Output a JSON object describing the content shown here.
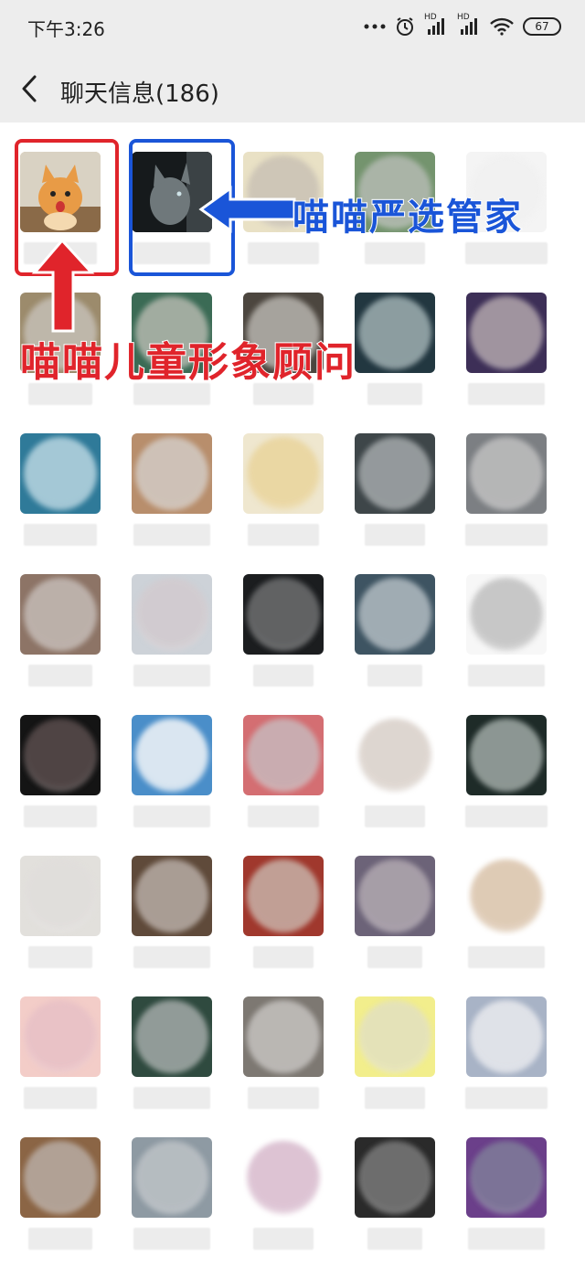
{
  "status_bar": {
    "time": "下午3:26",
    "battery": "67",
    "signal_label_1": "HD",
    "signal_label_2": "HD",
    "icons": [
      "more-dots-icon",
      "alarm-icon",
      "signal-icon",
      "signal-icon",
      "wifi-icon",
      "battery-icon"
    ]
  },
  "header": {
    "title": "聊天信息(186)",
    "back_icon": "chevron-left-icon"
  },
  "annotations": {
    "left_label": "喵喵儿童形象顾问",
    "right_label": "喵喵严选管家",
    "left_color": "#e0242b",
    "right_color": "#1a55d8"
  },
  "members": [
    {
      "avatar": "cat-photo",
      "bg": "#c9a57a",
      "blob": "#e7b27a"
    },
    {
      "avatar": "cat-photo-dark",
      "bg": "#1e2326",
      "blob": "#5c6466"
    },
    {
      "avatar": "blurred",
      "bg": "#e9e1c5",
      "blob": "#c9c1b4"
    },
    {
      "avatar": "blurred",
      "bg": "#74946e",
      "blob": "#b4bab2"
    },
    {
      "avatar": "blurred",
      "bg": "#f4f4f4",
      "blob": "#f0f0f0"
    },
    {
      "avatar": "blurred",
      "bg": "#9c8b6c",
      "blob": "#c5bfb6"
    },
    {
      "avatar": "blurred",
      "bg": "#3b6b55",
      "blob": "#b4b8ae"
    },
    {
      "avatar": "blurred",
      "bg": "#4c463f",
      "blob": "#b7b4ae"
    },
    {
      "avatar": "blurred",
      "bg": "#223740",
      "blob": "#9fb0b2"
    },
    {
      "avatar": "blurred",
      "bg": "#3d2f57",
      "blob": "#b2a6ac"
    },
    {
      "avatar": "blurred",
      "bg": "#2f7a99",
      "blob": "#b9d6e1"
    },
    {
      "avatar": "blurred",
      "bg": "#b88e6c",
      "blob": "#d2cbc5"
    },
    {
      "avatar": "blurred",
      "bg": "#efe7cf",
      "blob": "#e9d49c"
    },
    {
      "avatar": "blurred",
      "bg": "#3e4649",
      "blob": "#a4a9ab"
    },
    {
      "avatar": "blurred",
      "bg": "#7c7f83",
      "blob": "#c0c0c0"
    },
    {
      "avatar": "blurred",
      "bg": "#8d7466",
      "blob": "#c4bbb6"
    },
    {
      "avatar": "blurred",
      "bg": "#cdd2d8",
      "blob": "#d2cbcf"
    },
    {
      "avatar": "blurred",
      "bg": "#1b1d1f",
      "blob": "#6e6f70"
    },
    {
      "avatar": "blurred",
      "bg": "#3e5462",
      "blob": "#b2bcc2"
    },
    {
      "avatar": "blurred",
      "bg": "#f7f7f7",
      "blob": "#bfbfbf"
    },
    {
      "avatar": "blurred",
      "bg": "#141414",
      "blob": "#5a4d4d"
    },
    {
      "avatar": "blurred",
      "bg": "#4a8ec9",
      "blob": "#f4f6f8"
    },
    {
      "avatar": "blurred",
      "bg": "#d46e72",
      "blob": "#c7b8bb"
    },
    {
      "avatar": "blurred",
      "bg": "#ffffff",
      "blob": "#d8cfc8"
    },
    {
      "avatar": "blurred",
      "bg": "#1e2b28",
      "blob": "#a0aaa6"
    },
    {
      "avatar": "blurred",
      "bg": "#e2e0dc",
      "blob": "#e0dddb"
    },
    {
      "avatar": "blurred",
      "bg": "#5f4a3a",
      "blob": "#b7aca5"
    },
    {
      "avatar": "blurred",
      "bg": "#a0382d",
      "blob": "#c7b2a8"
    },
    {
      "avatar": "blurred",
      "bg": "#6c6378",
      "blob": "#b1a8b0"
    },
    {
      "avatar": "blurred",
      "bg": "#ffffff",
      "blob": "#d9c2a9"
    },
    {
      "avatar": "blurred",
      "bg": "#f3cdc8",
      "blob": "#e7c0c6"
    },
    {
      "avatar": "blurred",
      "bg": "#2f4a3f",
      "blob": "#a3aaa8"
    },
    {
      "avatar": "blurred",
      "bg": "#7d7872",
      "blob": "#c5c2bf"
    },
    {
      "avatar": "blurred",
      "bg": "#f2ee8c",
      "blob": "#e2e0c0"
    },
    {
      "avatar": "blurred",
      "bg": "#a8b3c6",
      "blob": "#e9eaee"
    },
    {
      "avatar": "blurred",
      "bg": "#8b6545",
      "blob": "#b8aca4"
    },
    {
      "avatar": "blurred",
      "bg": "#8e9aa3",
      "blob": "#bdc2c6"
    },
    {
      "avatar": "blurred",
      "bg": "#ffffff",
      "blob": "#d7b9cc"
    },
    {
      "avatar": "blurred",
      "bg": "#2a2a2a",
      "blob": "#7a7a7a"
    },
    {
      "avatar": "blurred",
      "bg": "#6b3f8a",
      "blob": "#7f7d99"
    }
  ]
}
